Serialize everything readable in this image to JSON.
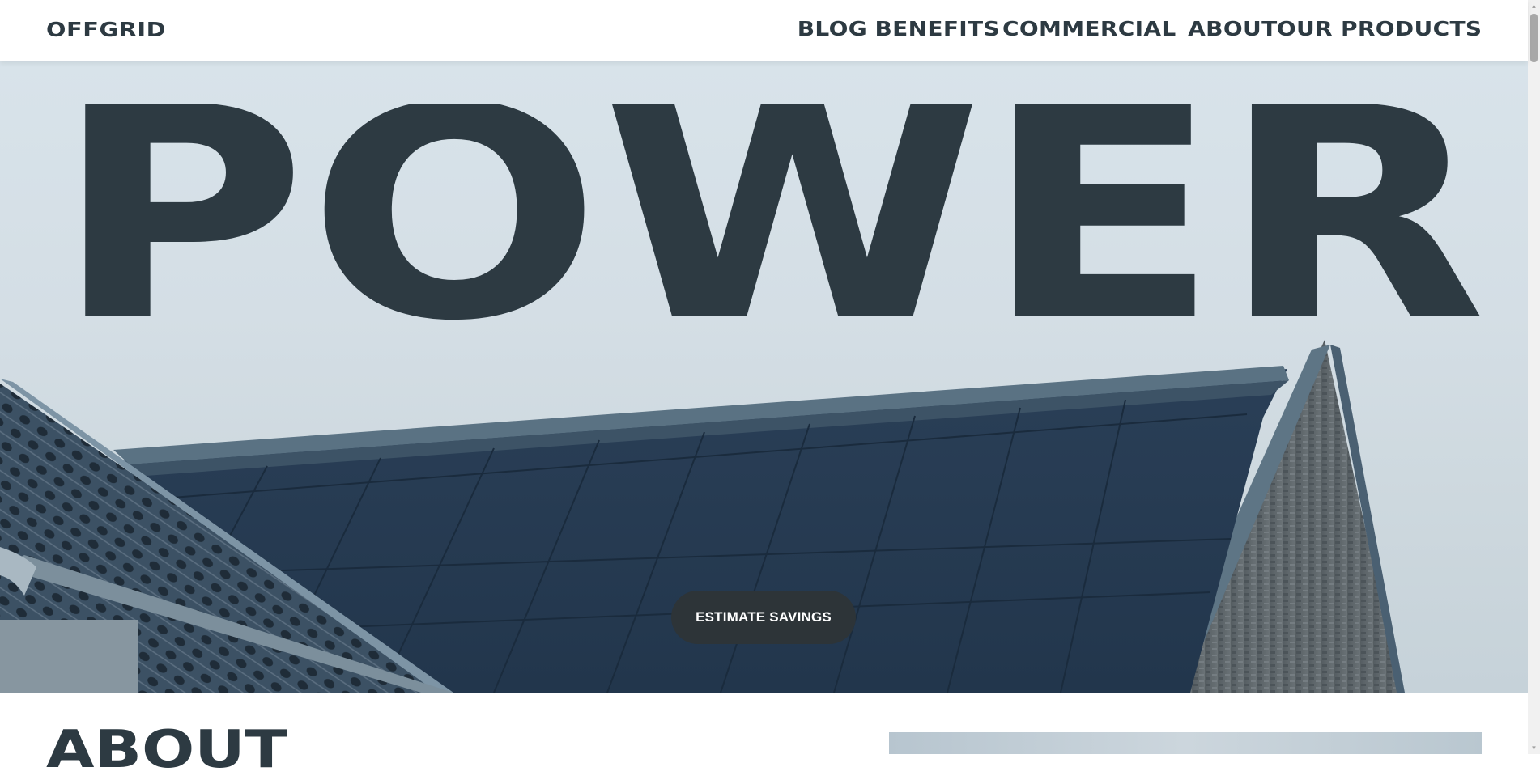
{
  "header": {
    "logo": "OFFGRID",
    "nav": [
      "BLOG",
      "BENEFITS",
      "COMMERCIAL",
      "ABOUT",
      "OUR PRODUCTS"
    ]
  },
  "hero": {
    "title": "POWER",
    "cta_label": "ESTIMATE SAVINGS",
    "image_icon": "solar-roof-photo"
  },
  "about": {
    "title": "ABOUT"
  },
  "colors": {
    "text": "#2d3a42",
    "button": "#2d3438",
    "sky": "#d6e1e8",
    "panel": "#26394f"
  }
}
